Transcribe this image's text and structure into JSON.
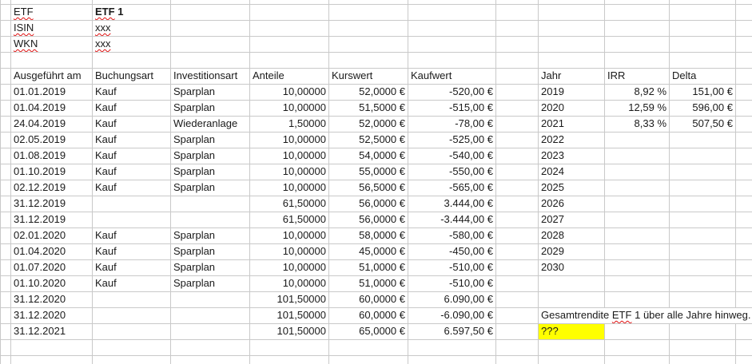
{
  "info": {
    "rows": [
      {
        "label": "ETF",
        "value": "ETF 1"
      },
      {
        "label": "ISIN",
        "value": "xxx"
      },
      {
        "label": "WKN",
        "value": "xxx"
      }
    ]
  },
  "transactions": {
    "headers": [
      "Ausgeführt am",
      "Buchungsart",
      "Investitionsart",
      "Anteile",
      "Kurswert",
      "Kaufwert"
    ],
    "rows": [
      {
        "date": "01.01.2019",
        "buchungsart": "Kauf",
        "investitionsart": "Sparplan",
        "anteile": "10,00000",
        "kurswert": "52,0000 €",
        "kaufwert": "-520,00 €",
        "negative": true
      },
      {
        "date": "01.04.2019",
        "buchungsart": "Kauf",
        "investitionsart": "Sparplan",
        "anteile": "10,00000",
        "kurswert": "51,5000 €",
        "kaufwert": "-515,00 €",
        "negative": true
      },
      {
        "date": "24.04.2019",
        "buchungsart": "Kauf",
        "investitionsart": "Wiederanlage",
        "anteile": "1,50000",
        "kurswert": "52,0000 €",
        "kaufwert": "-78,00 €",
        "negative": true
      },
      {
        "date": "02.05.2019",
        "buchungsart": "Kauf",
        "investitionsart": "Sparplan",
        "anteile": "10,00000",
        "kurswert": "52,5000 €",
        "kaufwert": "-525,00 €",
        "negative": true
      },
      {
        "date": "01.08.2019",
        "buchungsart": "Kauf",
        "investitionsart": "Sparplan",
        "anteile": "10,00000",
        "kurswert": "54,0000 €",
        "kaufwert": "-540,00 €",
        "negative": true
      },
      {
        "date": "01.10.2019",
        "buchungsart": "Kauf",
        "investitionsart": "Sparplan",
        "anteile": "10,00000",
        "kurswert": "55,0000 €",
        "kaufwert": "-550,00 €",
        "negative": true
      },
      {
        "date": "02.12.2019",
        "buchungsart": "Kauf",
        "investitionsart": "Sparplan",
        "anteile": "10,00000",
        "kurswert": "56,5000 €",
        "kaufwert": "-565,00 €",
        "negative": true
      },
      {
        "date": "31.12.2019",
        "buchungsart": "",
        "investitionsart": "",
        "anteile": "61,50000",
        "kurswert": "56,0000 €",
        "kaufwert": "3.444,00 €",
        "negative": false
      },
      {
        "date": "31.12.2019",
        "buchungsart": "",
        "investitionsart": "",
        "anteile": "61,50000",
        "kurswert": "56,0000 €",
        "kaufwert": "-3.444,00 €",
        "negative": false
      },
      {
        "date": "02.01.2020",
        "buchungsart": "Kauf",
        "investitionsart": "Sparplan",
        "anteile": "10,00000",
        "kurswert": "58,0000 €",
        "kaufwert": "-580,00 €",
        "negative": true
      },
      {
        "date": "01.04.2020",
        "buchungsart": "Kauf",
        "investitionsart": "Sparplan",
        "anteile": "10,00000",
        "kurswert": "45,0000 €",
        "kaufwert": "-450,00 €",
        "negative": true
      },
      {
        "date": "01.07.2020",
        "buchungsart": "Kauf",
        "investitionsart": "Sparplan",
        "anteile": "10,00000",
        "kurswert": "51,0000 €",
        "kaufwert": "-510,00 €",
        "negative": true
      },
      {
        "date": "01.10.2020",
        "buchungsart": "Kauf",
        "investitionsart": "Sparplan",
        "anteile": "10,00000",
        "kurswert": "51,0000 €",
        "kaufwert": "-510,00 €",
        "negative": true
      },
      {
        "date": "31.12.2020",
        "buchungsart": "",
        "investitionsart": "",
        "anteile": "101,50000",
        "kurswert": "60,0000 €",
        "kaufwert": "6.090,00 €",
        "negative": false
      },
      {
        "date": "31.12.2020",
        "buchungsart": "",
        "investitionsart": "",
        "anteile": "101,50000",
        "kurswert": "60,0000 €",
        "kaufwert": "-6.090,00 €",
        "negative": false
      },
      {
        "date": "31.12.2021",
        "buchungsart": "",
        "investitionsart": "",
        "anteile": "101,50000",
        "kurswert": "65,0000 €",
        "kaufwert": "6.597,50 €",
        "negative": false
      }
    ]
  },
  "years": {
    "headers": [
      "Jahr",
      "IRR",
      "Delta"
    ],
    "rows": [
      {
        "jahr": "2019",
        "irr": "8,92 %",
        "delta": "151,00 €"
      },
      {
        "jahr": "2020",
        "irr": "12,59 %",
        "delta": "596,00 €"
      },
      {
        "jahr": "2021",
        "irr": "8,33 %",
        "delta": "507,50 €"
      },
      {
        "jahr": "2022",
        "irr": "",
        "delta": ""
      },
      {
        "jahr": "2023",
        "irr": "",
        "delta": ""
      },
      {
        "jahr": "2024",
        "irr": "",
        "delta": ""
      },
      {
        "jahr": "2025",
        "irr": "",
        "delta": ""
      },
      {
        "jahr": "2026",
        "irr": "",
        "delta": ""
      },
      {
        "jahr": "2027",
        "irr": "",
        "delta": ""
      },
      {
        "jahr": "2028",
        "irr": "",
        "delta": ""
      },
      {
        "jahr": "2029",
        "irr": "",
        "delta": ""
      },
      {
        "jahr": "2030",
        "irr": "",
        "delta": ""
      }
    ]
  },
  "summary": {
    "label": "Gesamtrendite ETF 1 über alle Jahre hinweg.",
    "placeholder": "???"
  },
  "spellcheck": {
    "flagged_words": [
      "ETF",
      "ISIN",
      "WKN",
      "xxx"
    ]
  },
  "colors": {
    "negative_red": "#ee3333",
    "highlight_yellow": "#ffff00",
    "misspell_red": "#e11111",
    "gridline_gray": "#c9c9c9"
  }
}
